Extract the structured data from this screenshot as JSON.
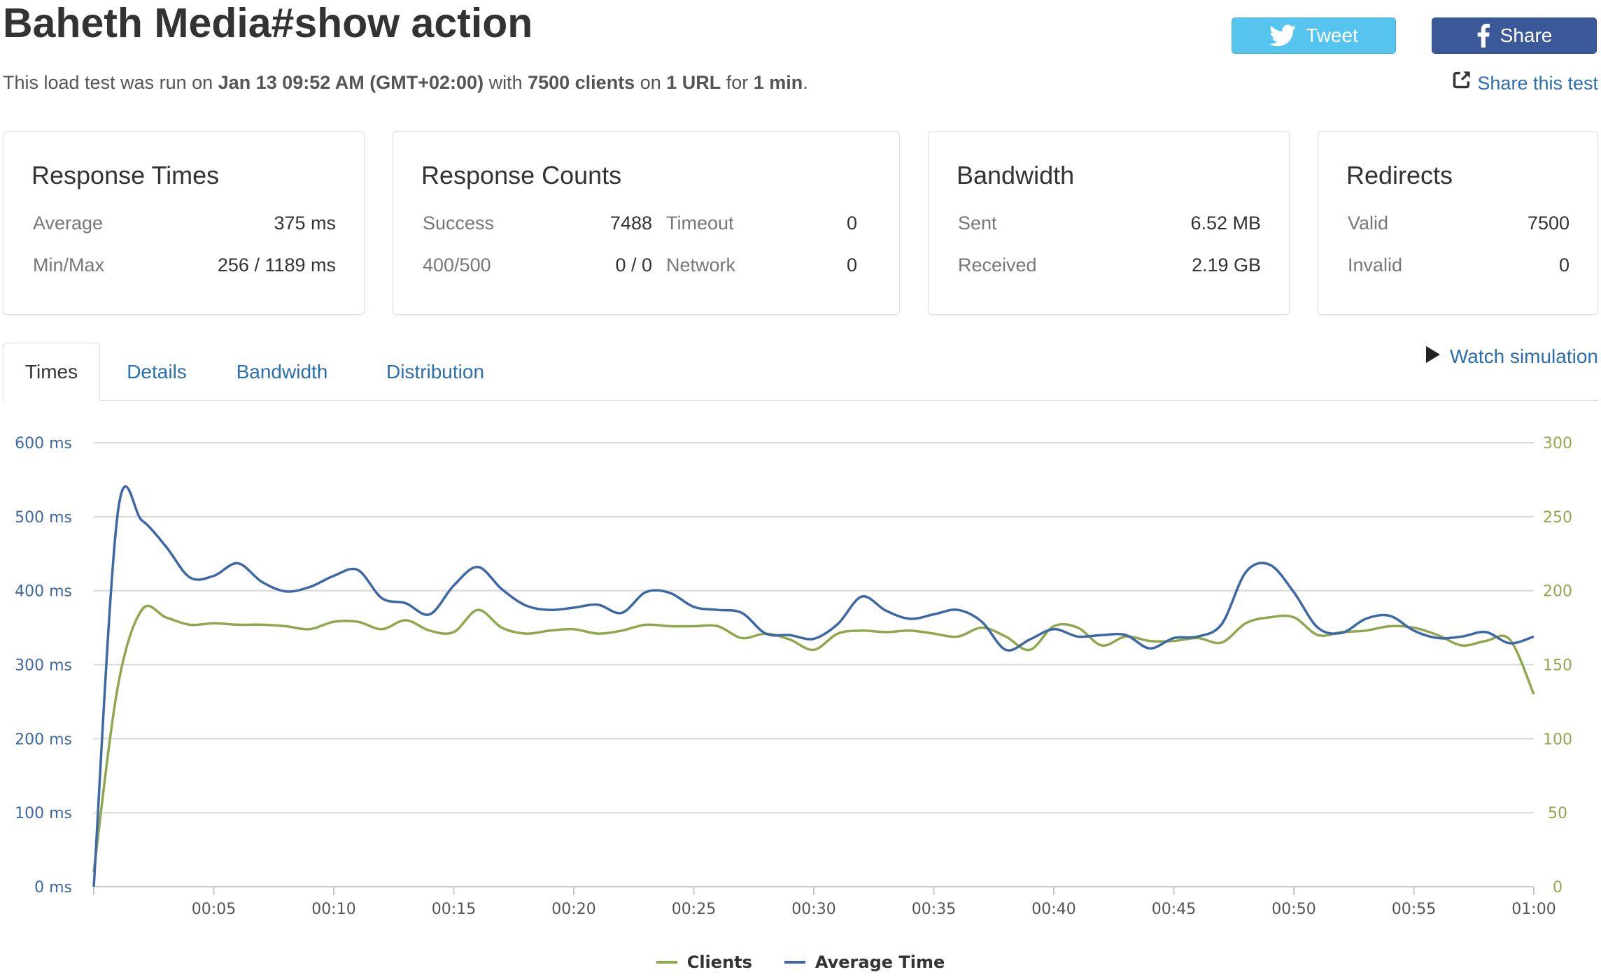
{
  "header": {
    "title": "Baheth Media#show action",
    "summary": {
      "prefix": "This load test was run on ",
      "date": "Jan 13 09:52 AM (GMT+02:00)",
      "with": " with ",
      "clients": "7500 clients",
      "on": " on ",
      "urls": "1 URL",
      "for": " for ",
      "duration": "1 min",
      "suffix": "."
    },
    "tweet_label": "Tweet",
    "share_label": "Share",
    "share_test_label": "Share this test",
    "icons": {
      "tweet": "twitter-bird-icon",
      "share": "facebook-f-icon",
      "share_test": "external-share-icon"
    },
    "colors": {
      "tweet": "#55c5ef",
      "share": "#3b5998",
      "link": "#2a6fb2"
    }
  },
  "cards": {
    "response_times": {
      "title": "Response Times",
      "average_label": "Average",
      "average_value": "375 ms",
      "minmax_label": "Min/Max",
      "minmax_value": "256 / 1189 ms"
    },
    "response_counts": {
      "title": "Response Counts",
      "success_label": "Success",
      "success_value": "7488",
      "timeout_label": "Timeout",
      "timeout_value": "0",
      "errors_label": "400/500",
      "errors_value": "0 / 0",
      "network_label": "Network",
      "network_value": "0"
    },
    "bandwidth": {
      "title": "Bandwidth",
      "sent_label": "Sent",
      "sent_value": "6.52 MB",
      "received_label": "Received",
      "received_value": "2.19 GB"
    },
    "redirects": {
      "title": "Redirects",
      "valid_label": "Valid",
      "valid_value": "7500",
      "invalid_label": "Invalid",
      "invalid_value": "0"
    }
  },
  "tabs": [
    {
      "label": "Times",
      "active": true
    },
    {
      "label": "Details",
      "active": false
    },
    {
      "label": "Bandwidth",
      "active": false
    },
    {
      "label": "Distribution",
      "active": false
    }
  ],
  "watch_label": "Watch simulation",
  "chart_data": {
    "type": "line",
    "x_ticks": [
      "00:05",
      "00:10",
      "00:15",
      "00:20",
      "00:25",
      "00:30",
      "00:35",
      "00:40",
      "00:45",
      "00:50",
      "00:55",
      "01:00"
    ],
    "xlim": [
      0,
      60
    ],
    "y_left": {
      "ticks": [
        "0 ms",
        "100 ms",
        "200 ms",
        "300 ms",
        "400 ms",
        "500 ms",
        "600 ms"
      ],
      "ylim": [
        0,
        600
      ]
    },
    "y_right": {
      "ticks": [
        "0",
        "50",
        "100",
        "150",
        "200",
        "250",
        "300"
      ],
      "ylim": [
        0,
        300
      ]
    },
    "grid": true,
    "legend_position": "bottom",
    "series": [
      {
        "name": "Clients",
        "axis": "right",
        "color": "#8fa84d",
        "points": [
          [
            0,
            10
          ],
          [
            1,
            135
          ],
          [
            2,
            187
          ],
          [
            3,
            182
          ],
          [
            4,
            177
          ],
          [
            5,
            178
          ],
          [
            6,
            177
          ],
          [
            7,
            177
          ],
          [
            8,
            176
          ],
          [
            9,
            174
          ],
          [
            10,
            179
          ],
          [
            11,
            179
          ],
          [
            12,
            174
          ],
          [
            13,
            180
          ],
          [
            14,
            173
          ],
          [
            15,
            172
          ],
          [
            16,
            187
          ],
          [
            17,
            175
          ],
          [
            18,
            171
          ],
          [
            19,
            173
          ],
          [
            20,
            174
          ],
          [
            21,
            171
          ],
          [
            22,
            173
          ],
          [
            23,
            177
          ],
          [
            24,
            176
          ],
          [
            25,
            176
          ],
          [
            26,
            176
          ],
          [
            27,
            168
          ],
          [
            28,
            171
          ],
          [
            29,
            167
          ],
          [
            30,
            160
          ],
          [
            31,
            171
          ],
          [
            32,
            173
          ],
          [
            33,
            172
          ],
          [
            34,
            173
          ],
          [
            35,
            171
          ],
          [
            36,
            169
          ],
          [
            37,
            175
          ],
          [
            38,
            169
          ],
          [
            39,
            160
          ],
          [
            40,
            176
          ],
          [
            41,
            175
          ],
          [
            42,
            163
          ],
          [
            43,
            169
          ],
          [
            44,
            166
          ],
          [
            45,
            166
          ],
          [
            46,
            168
          ],
          [
            47,
            165
          ],
          [
            48,
            178
          ],
          [
            49,
            182
          ],
          [
            50,
            182
          ],
          [
            51,
            170
          ],
          [
            52,
            172
          ],
          [
            53,
            173
          ],
          [
            54,
            176
          ],
          [
            55,
            175
          ],
          [
            56,
            170
          ],
          [
            57,
            163
          ],
          [
            58,
            166
          ],
          [
            59,
            167
          ],
          [
            60,
            130
          ]
        ]
      },
      {
        "name": "Average Time",
        "axis": "left",
        "color": "#3d67a5",
        "points": [
          [
            0,
            0
          ],
          [
            1,
            505
          ],
          [
            2,
            495
          ],
          [
            3,
            460
          ],
          [
            4,
            418
          ],
          [
            5,
            420
          ],
          [
            6,
            437
          ],
          [
            7,
            412
          ],
          [
            8,
            399
          ],
          [
            9,
            405
          ],
          [
            10,
            420
          ],
          [
            11,
            428
          ],
          [
            12,
            390
          ],
          [
            13,
            383
          ],
          [
            14,
            368
          ],
          [
            15,
            407
          ],
          [
            16,
            432
          ],
          [
            17,
            402
          ],
          [
            18,
            380
          ],
          [
            19,
            374
          ],
          [
            20,
            377
          ],
          [
            21,
            381
          ],
          [
            22,
            370
          ],
          [
            23,
            398
          ],
          [
            24,
            397
          ],
          [
            25,
            378
          ],
          [
            26,
            374
          ],
          [
            27,
            370
          ],
          [
            28,
            342
          ],
          [
            29,
            340
          ],
          [
            30,
            335
          ],
          [
            31,
            355
          ],
          [
            32,
            392
          ],
          [
            33,
            373
          ],
          [
            34,
            362
          ],
          [
            35,
            368
          ],
          [
            36,
            374
          ],
          [
            37,
            358
          ],
          [
            38,
            320
          ],
          [
            39,
            334
          ],
          [
            40,
            348
          ],
          [
            41,
            338
          ],
          [
            42,
            340
          ],
          [
            43,
            340
          ],
          [
            44,
            322
          ],
          [
            45,
            336
          ],
          [
            46,
            338
          ],
          [
            47,
            355
          ],
          [
            48,
            425
          ],
          [
            49,
            435
          ],
          [
            50,
            398
          ],
          [
            51,
            350
          ],
          [
            52,
            343
          ],
          [
            53,
            362
          ],
          [
            54,
            366
          ],
          [
            55,
            346
          ],
          [
            56,
            336
          ],
          [
            57,
            338
          ],
          [
            58,
            344
          ],
          [
            59,
            329
          ],
          [
            60,
            338
          ]
        ]
      }
    ]
  }
}
